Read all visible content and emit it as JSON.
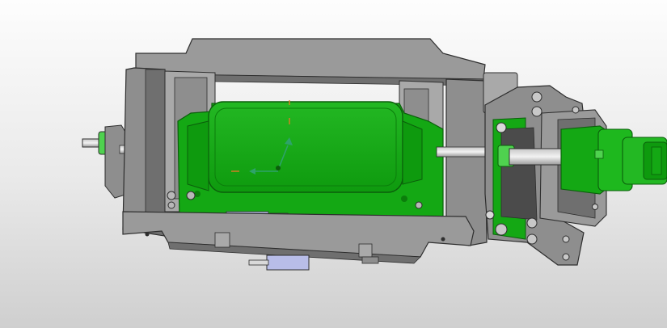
{
  "viewport": {
    "background_top": "#fdfdfd",
    "background_bottom": "#cfcfcf"
  },
  "model": {
    "frame_color": "#8e8e8e",
    "frame_shade": "#6f6f6f",
    "frame_light": "#a9a9a9",
    "part_color": "#14a814",
    "part_dark": "#0b7e0b",
    "part_light": "#4fd24f",
    "highlight_color": "#b8bde8",
    "edge_color": "#2e2e2e"
  },
  "triad": {
    "x_color": "#e07b25",
    "y_color": "#2ea36a",
    "z_color": "#e07b25",
    "icons": [
      "axis-triad-icon",
      "origin-marker-icon"
    ]
  }
}
